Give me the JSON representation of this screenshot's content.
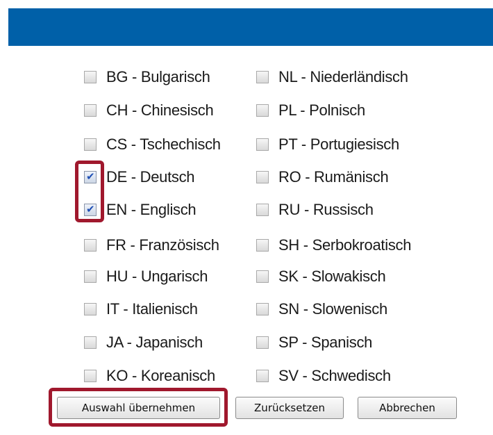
{
  "dialog": {
    "header_color": "#0060a8",
    "highlight_color": "#a0182d"
  },
  "languages": [
    {
      "label": "BG - Bulgarisch",
      "checked": false
    },
    {
      "label": "CH - Chinesisch",
      "checked": false
    },
    {
      "label": "CS - Tschechisch",
      "checked": false
    },
    {
      "label": "DE - Deutsch",
      "checked": true
    },
    {
      "label": "EN - Englisch",
      "checked": true
    },
    {
      "label": "FR - Französisch",
      "checked": false
    },
    {
      "label": "HU - Ungarisch",
      "checked": false
    },
    {
      "label": "IT - Italienisch",
      "checked": false
    },
    {
      "label": "JA - Japanisch",
      "checked": false
    },
    {
      "label": "KO - Koreanisch",
      "checked": false
    },
    {
      "label": "NL - Niederländisch",
      "checked": false
    },
    {
      "label": "PL - Polnisch",
      "checked": false
    },
    {
      "label": "PT - Portugiesisch",
      "checked": false
    },
    {
      "label": "RO - Rumänisch",
      "checked": false
    },
    {
      "label": "RU - Russisch",
      "checked": false
    },
    {
      "label": "SH - Serbokroatisch",
      "checked": false
    },
    {
      "label": "SK - Slowakisch",
      "checked": false
    },
    {
      "label": "SN - Slowenisch",
      "checked": false
    },
    {
      "label": "SP - Spanisch",
      "checked": false
    },
    {
      "label": "SV - Schwedisch",
      "checked": false
    }
  ],
  "buttons": {
    "apply_label": "Auswahl übernehmen",
    "reset_label": "Zurücksetzen",
    "cancel_label": "Abbrechen"
  }
}
